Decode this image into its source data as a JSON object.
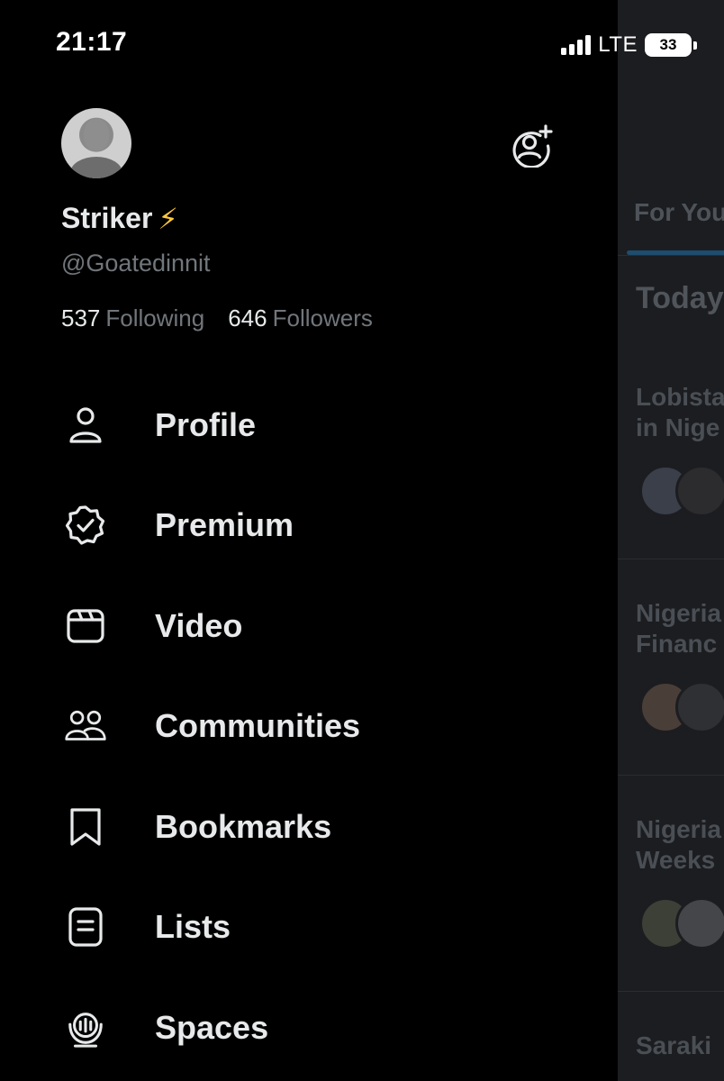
{
  "status_bar": {
    "time": "21:17",
    "network": "LTE",
    "battery": "33"
  },
  "profile": {
    "display_name": "Striker",
    "name_emoji": "⚡",
    "handle": "@Goatedinnit",
    "following_count": "537",
    "following_label": "Following",
    "followers_count": "646",
    "followers_label": "Followers"
  },
  "menu": {
    "items": [
      {
        "label": "Profile",
        "icon": "person-icon"
      },
      {
        "label": "Premium",
        "icon": "verified-badge-icon"
      },
      {
        "label": "Video",
        "icon": "video-icon"
      },
      {
        "label": "Communities",
        "icon": "communities-icon"
      },
      {
        "label": "Bookmarks",
        "icon": "bookmark-icon"
      },
      {
        "label": "Lists",
        "icon": "list-icon"
      },
      {
        "label": "Spaces",
        "icon": "spaces-icon"
      }
    ]
  },
  "timeline": {
    "tab": "For You",
    "section_heading": "Today",
    "items": [
      {
        "line1": "Lobista",
        "line2": "in Nige"
      },
      {
        "line1": "Nigeria",
        "line2": "Financ"
      },
      {
        "line1": "Nigeria",
        "line2": "Weeks"
      },
      {
        "line1": "Saraki",
        "line2": ""
      }
    ]
  },
  "colors": {
    "background": "#000000",
    "text_primary": "#e7e9ea",
    "text_secondary": "#71767b",
    "lightning": "#ffc83d",
    "timeline_overlay": "#1c1d20"
  }
}
